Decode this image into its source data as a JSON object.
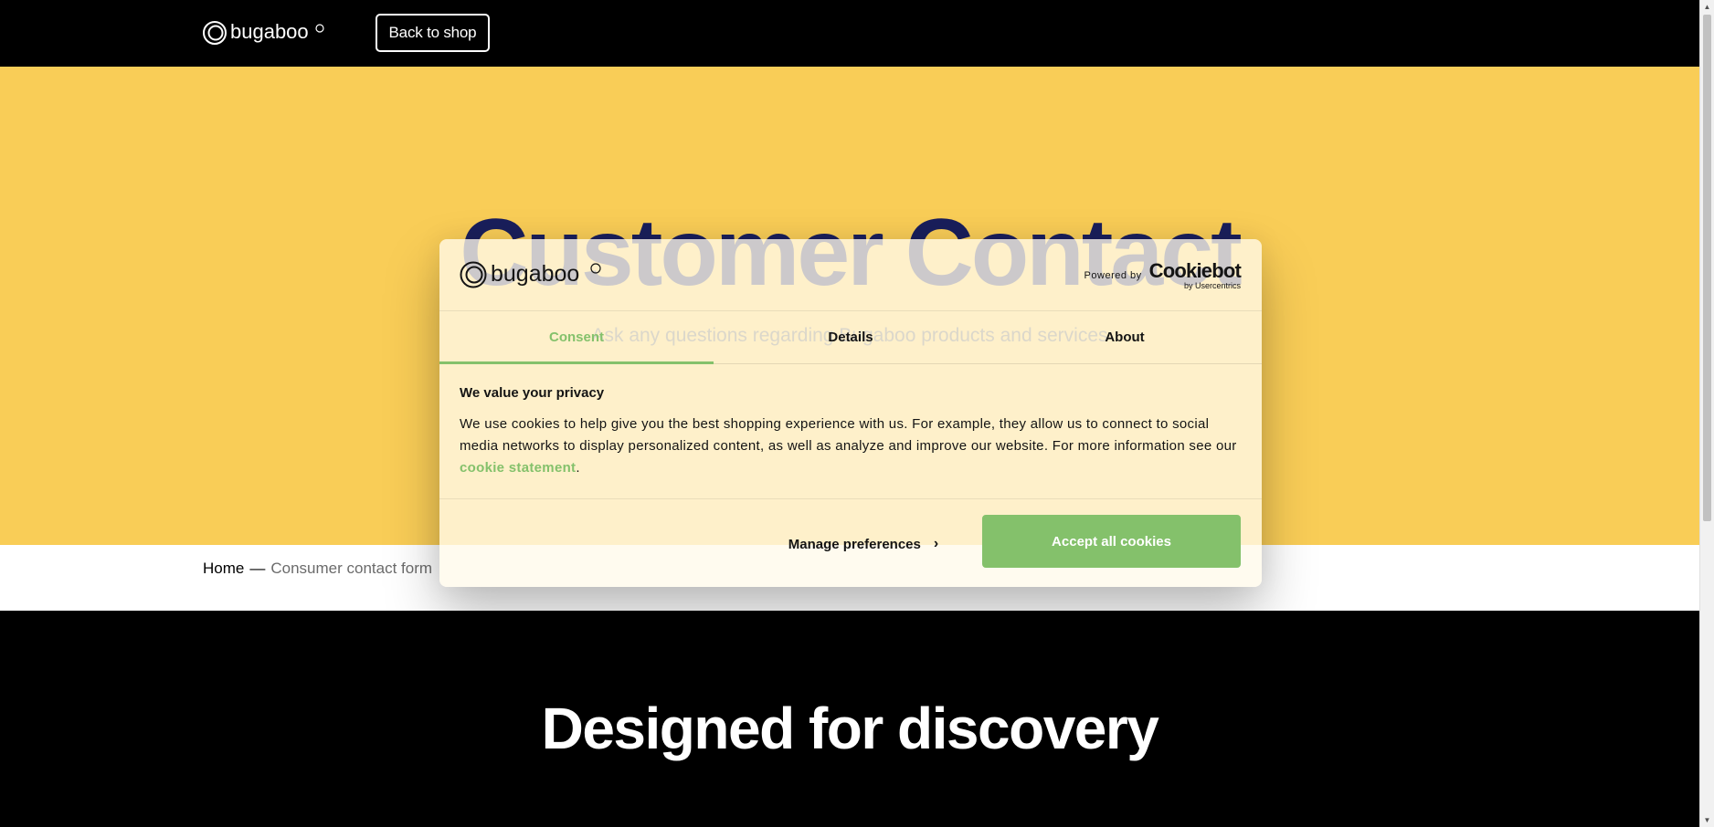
{
  "header": {
    "logo_alt": "bugaboo",
    "back_button": "Back to shop"
  },
  "hero": {
    "title": "Customer Contact",
    "subtitle": "Ask any questions regarding Bugaboo products and services"
  },
  "breadcrumb": {
    "home": "Home",
    "separator": "—",
    "current": "Consumer contact form"
  },
  "footer": {
    "title": "Designed for discovery"
  },
  "cookie_dialog": {
    "logo": "bugaboo",
    "powered_by": "Powered by",
    "cookiebot": "Cookiebot",
    "cookiebot_sub": "by Usercentrics",
    "tabs": [
      {
        "label": "Consent",
        "active": true
      },
      {
        "label": "Details",
        "active": false
      },
      {
        "label": "About",
        "active": false
      }
    ],
    "heading": "We value your privacy",
    "text_before_link": "We use cookies to help give you the best shopping experience with us. For example, they allow us to connect to social media networks to display personalized content, as well as analyze and improve our website. For more information see our ",
    "link_text": "cookie statement",
    "text_after_link": ".",
    "manage_button": "Manage preferences",
    "accept_button": "Accept all cookies"
  },
  "colors": {
    "hero_bg": "#f9cd57",
    "title_color": "#1a1f5c",
    "accent_green": "#84c16b"
  }
}
